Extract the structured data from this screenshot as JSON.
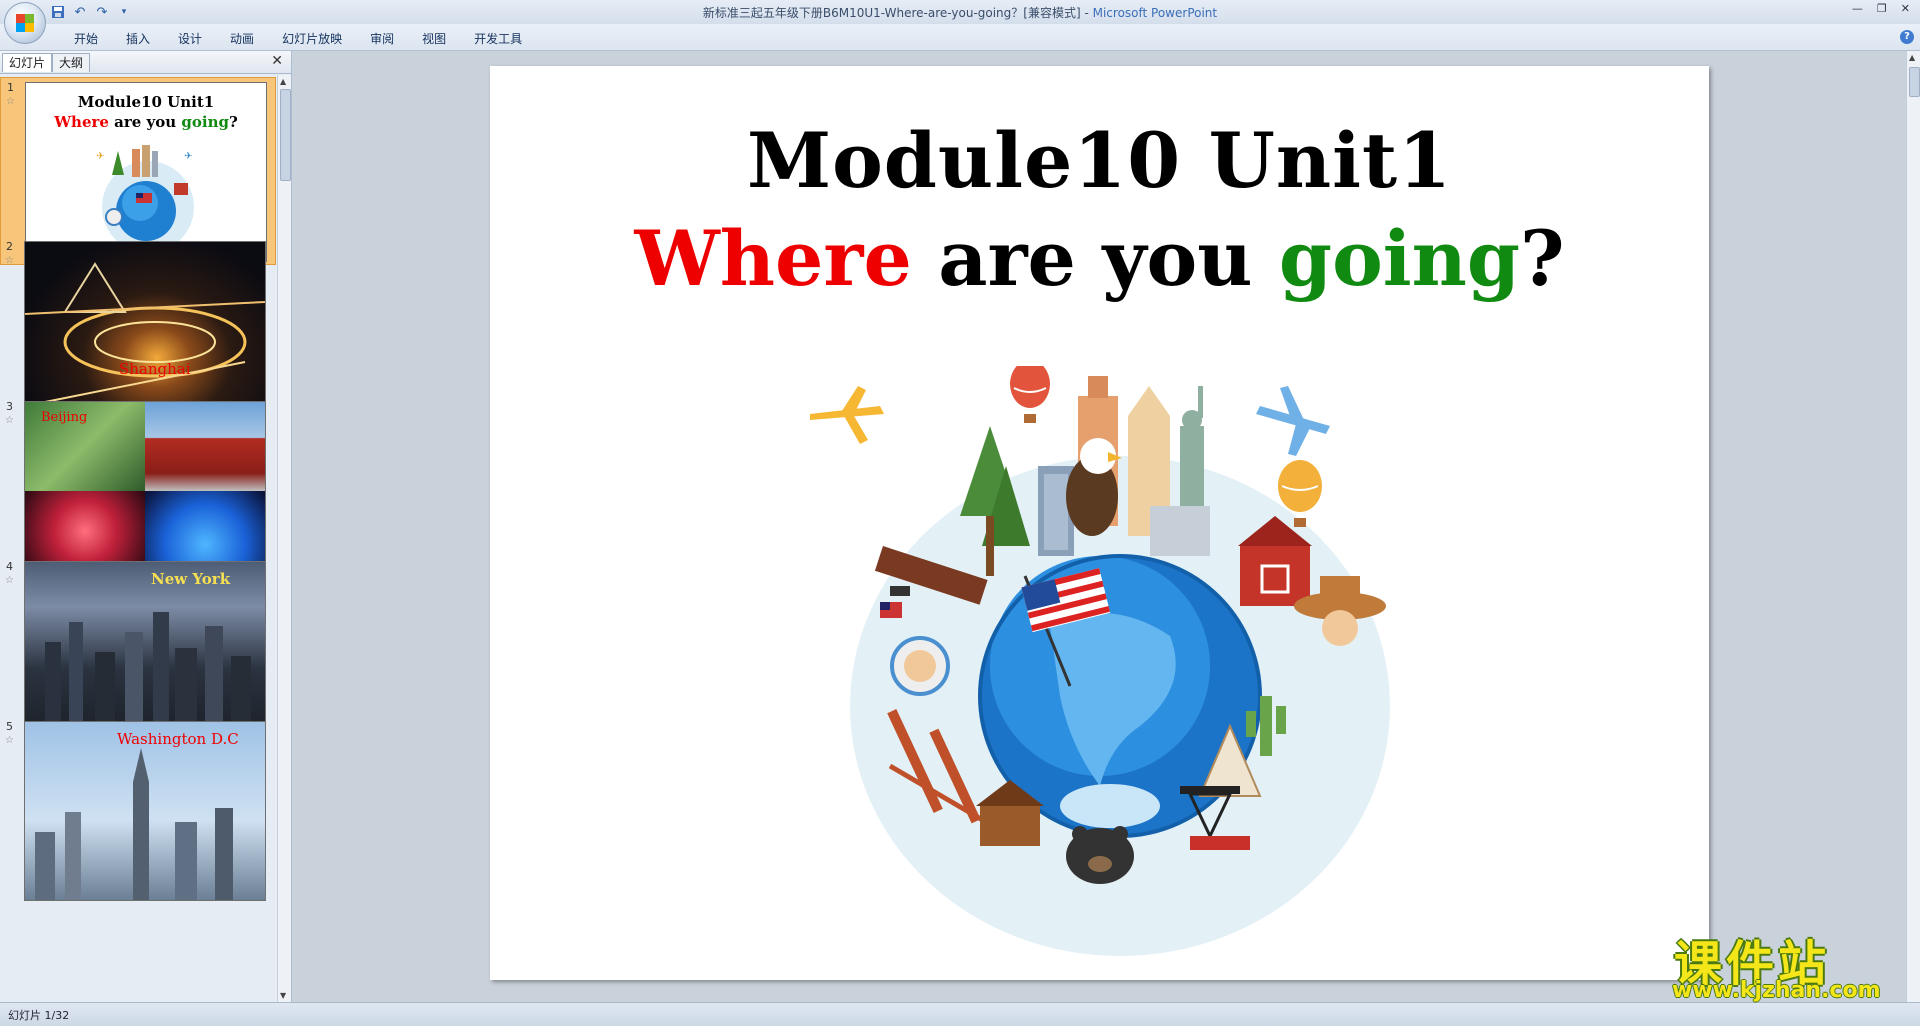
{
  "window": {
    "title": "新标准三起五年级下册B6M10U1-Where-are-you-going？[兼容模式] - ",
    "app_name": "Microsoft PowerPoint"
  },
  "ribbon": {
    "tabs": [
      "开始",
      "插入",
      "设计",
      "动画",
      "幻灯片放映",
      "审阅",
      "视图",
      "开发工具"
    ]
  },
  "panel": {
    "tab_slides": "幻灯片",
    "tab_outline": "大纲",
    "close_glyph": "✕",
    "thumbnails": [
      {
        "num": "1",
        "title_line1": "Module10 Unit1",
        "title_where": "Where",
        "title_mid": " are you ",
        "title_going": "going",
        "title_end": "?"
      },
      {
        "num": "2",
        "label": "Shanghai"
      },
      {
        "num": "3",
        "label": "Beijing"
      },
      {
        "num": "4",
        "label": "New York"
      },
      {
        "num": "5",
        "label": "Washington D.C"
      }
    ]
  },
  "slide": {
    "title_line1": "Module10 Unit1",
    "where": "Where",
    "middle": " are you ",
    "going": "going",
    "question_mark": "?"
  },
  "status": {
    "slide_counter": "幻灯片 1/32"
  },
  "watermark": {
    "chinese": "课件站",
    "url": "www.kjzhan.com"
  },
  "colors": {
    "red_text": "#ee0000",
    "green_text": "#118a11",
    "selected_thumb": "#f8c67a"
  },
  "icons": [
    "office-button-icon",
    "save-icon",
    "undo-icon",
    "redo-icon",
    "customize-icon",
    "minimize-icon",
    "restore-icon",
    "close-icon",
    "help-icon",
    "scroll-up-icon",
    "scroll-down-icon"
  ]
}
